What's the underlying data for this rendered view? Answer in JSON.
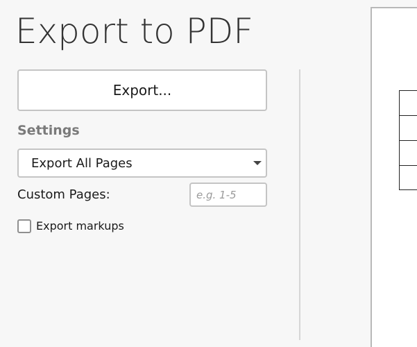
{
  "header": {
    "title": "Export to PDF"
  },
  "export_button": {
    "label": "Export..."
  },
  "settings": {
    "heading": "Settings",
    "page_range_select": {
      "selected": "Export All Pages",
      "icon": "chevron-down-icon"
    },
    "custom_pages": {
      "label": "Custom Pages:",
      "value": "",
      "placeholder": "e.g. 1-5"
    },
    "export_markups": {
      "label": "Export markups",
      "checked": false
    }
  },
  "colors": {
    "background": "#f7f7f7",
    "border": "#c4c4c4",
    "heading_gray": "#7a7a7a",
    "divider": "#d6d6d6"
  }
}
